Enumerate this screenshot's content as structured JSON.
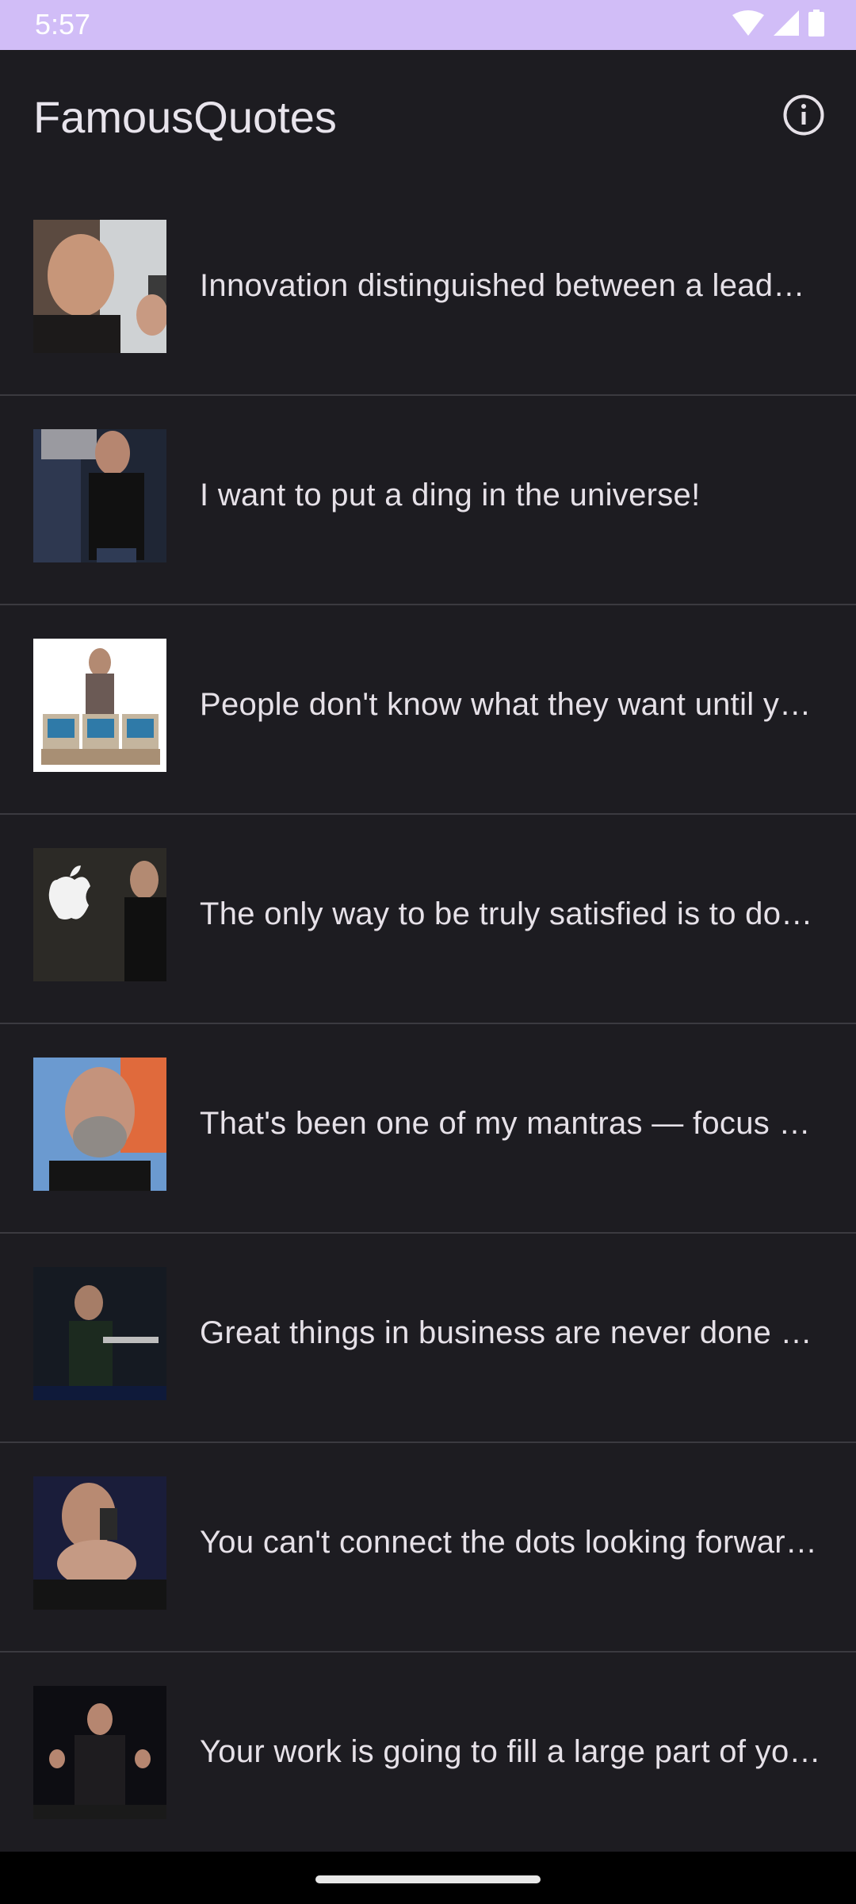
{
  "status_bar": {
    "time": "5:57",
    "icons": [
      "wifi-icon",
      "signal-icon",
      "battery-icon"
    ],
    "color": "#d1bdf7"
  },
  "app_bar": {
    "title": "FamousQuotes",
    "action_icon": "info-icon"
  },
  "quotes": [
    {
      "text": "Innovation distinguished between a leader and a follower.",
      "image": "portrait of man holding phone"
    },
    {
      "text": "I want to put a ding in the universe!",
      "image": "man on stage holding laptop"
    },
    {
      "text": "People don't know what they want until you show it to them.",
      "image": "man standing over computers"
    },
    {
      "text": "The only way to be truly satisfied is to do what you believe is great work.",
      "image": "apple logo and man"
    },
    {
      "text": "That's been one of my mantras — focus and simplicity.",
      "image": "close-up portrait of man with beard"
    },
    {
      "text": "Great things in business are never done by one person.",
      "image": "man on stage presenting laptop"
    },
    {
      "text": "You can't connect the dots looking forward; you can only connect them looking backwards.",
      "image": "man holding phone on stage"
    },
    {
      "text": "Your work is going to fill a large part of your life.",
      "image": "man gesturing on stage"
    }
  ],
  "colors": {
    "background": "#1d1c21",
    "divider": "#3b3a40",
    "text": "#e6e1e8"
  }
}
